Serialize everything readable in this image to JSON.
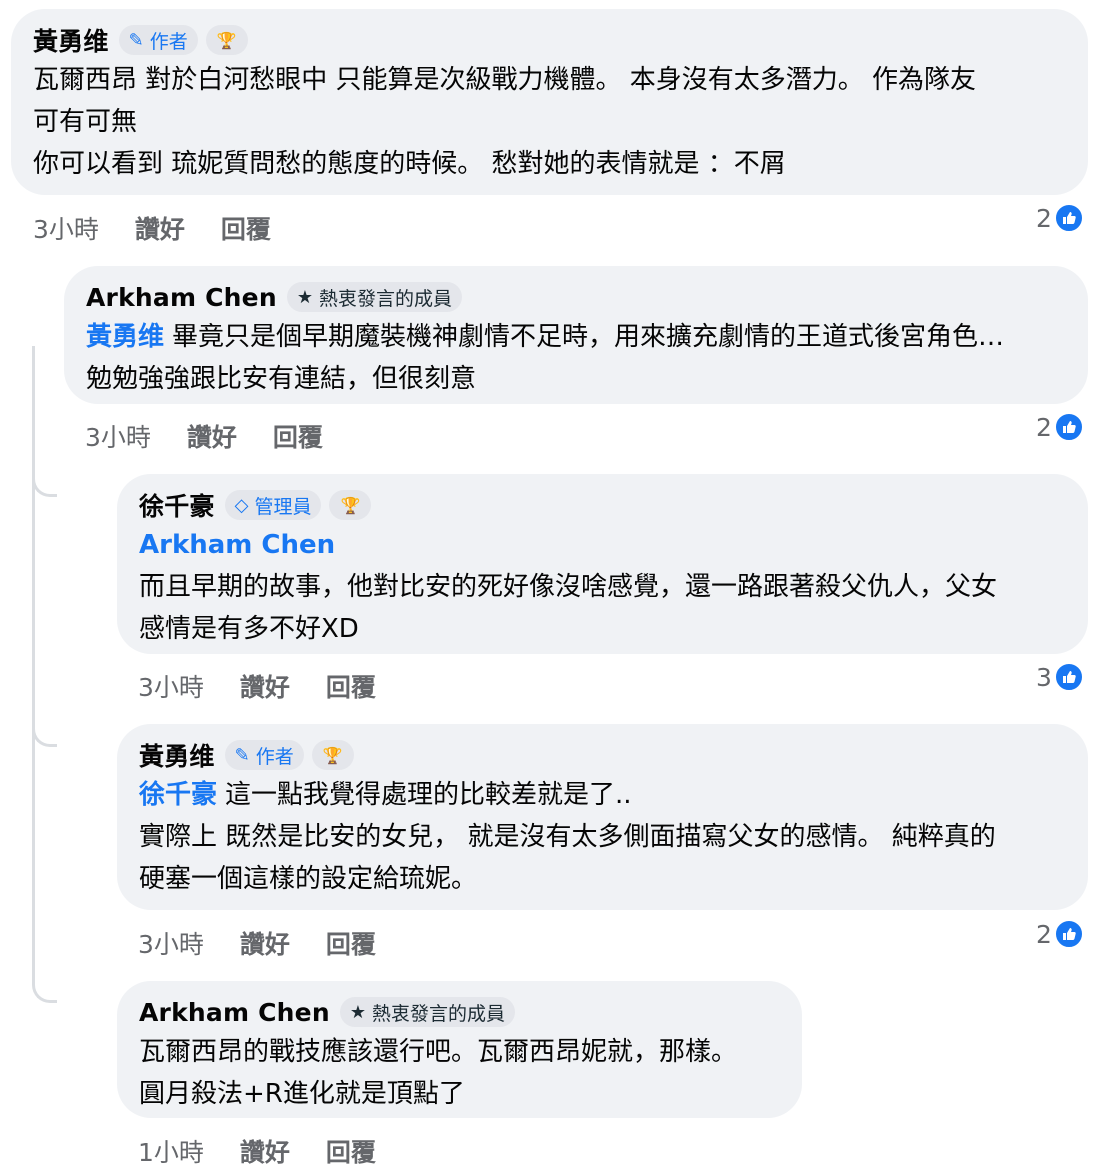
{
  "comments": [
    {
      "author": "黃勇维",
      "badge": "作者",
      "badge_icon": "pencil-icon",
      "has_trophy": true,
      "lines": [
        "瓦爾西昂 對於白河愁眼中 只能算是次級戰力機體。 本身沒有太多潛力。 作為隊友",
        "可有可無",
        "你可以看到 琉妮質問愁的態度的時候。 愁對她的表情就是 ：不屑"
      ],
      "time": "3小時",
      "like_label": "讚好",
      "reply_label": "回覆",
      "reactions": "2"
    },
    {
      "author": "Arkham Chen",
      "badge": "熱衷發言的成員",
      "badge_icon": "star-icon",
      "mention": "黃勇维",
      "lines": [
        "畢竟只是個早期魔裝機神劇情不足時，用來擴充劇情的王道式後宮角色…",
        "勉勉強強跟比安有連結，但很刻意"
      ],
      "time": "3小時",
      "like_label": "讚好",
      "reply_label": "回覆",
      "reactions": "2"
    },
    {
      "author": "徐千豪",
      "badge": "管理員",
      "badge_icon": "admin-shield-icon",
      "has_trophy": true,
      "mention": "Arkham Chen",
      "lines": [
        "而且早期的故事，他對比安的死好像沒啥感覺，還一路跟著殺父仇人，父女",
        "感情是有多不好XD"
      ],
      "time": "3小時",
      "like_label": "讚好",
      "reply_label": "回覆",
      "reactions": "3"
    },
    {
      "author": "黃勇维",
      "badge": "作者",
      "badge_icon": "pencil-icon",
      "has_trophy": true,
      "mention": "徐千豪",
      "lines": [
        "這一點我覺得處理的比較差就是了..",
        "實際上 既然是比安的女兒， 就是沒有太多側面描寫父女的感情。 純粹真的",
        "硬塞一個這樣的設定給琉妮。"
      ],
      "time": "3小時",
      "like_label": "讚好",
      "reply_label": "回覆",
      "reactions": "2"
    },
    {
      "author": "Arkham Chen",
      "badge": "熱衷發言的成員",
      "badge_icon": "star-icon",
      "lines": [
        "瓦爾西昂的戰技應該還行吧。瓦爾西昂妮就，那樣。",
        "圓月殺法+R進化就是頂點了"
      ],
      "time": "1小時",
      "like_label": "讚好",
      "reply_label": "回覆"
    }
  ],
  "colors": {
    "bubble": "#f0f2f5",
    "mention": "#1877f2",
    "meta": "#65676b",
    "like": "#1877f2"
  }
}
